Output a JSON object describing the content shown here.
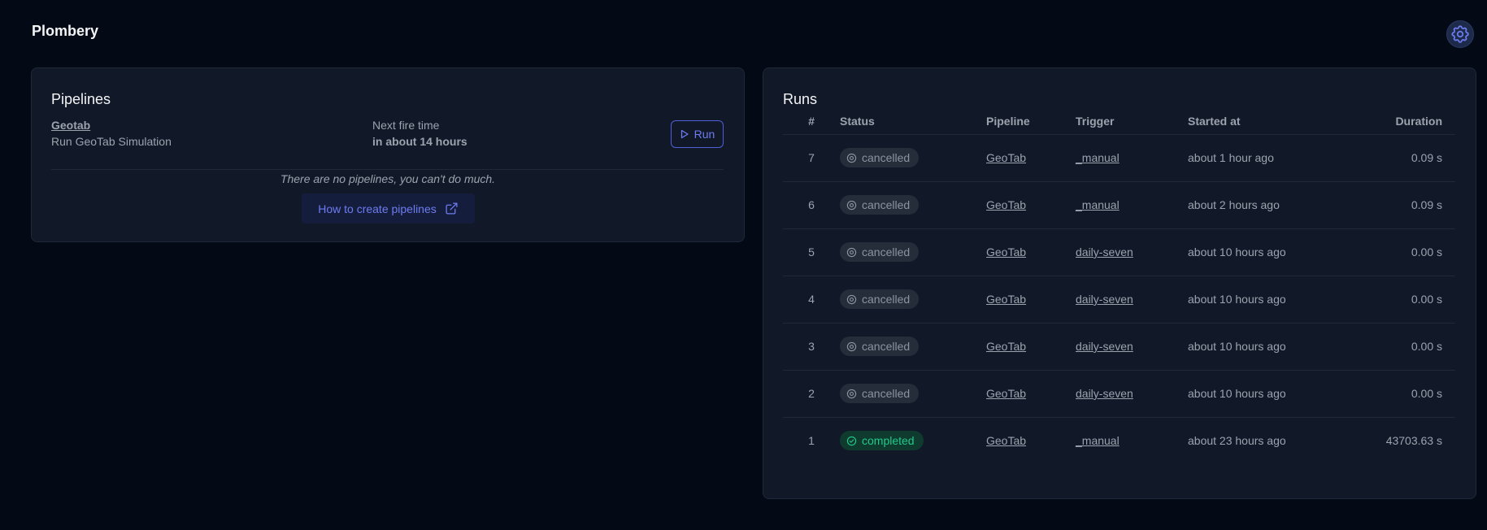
{
  "app": {
    "title": "Plombery",
    "settings_icon": "gear-icon"
  },
  "pipelines": {
    "title": "Pipelines",
    "item": {
      "name": "Geotab",
      "description": "Run GeoTab Simulation",
      "next_fire_label": "Next fire time",
      "next_fire_value": "in about 14 hours",
      "run_label": "Run"
    },
    "empty_message": "There are no pipelines, you can't do much.",
    "howto_label": "How to create pipelines"
  },
  "runs": {
    "title": "Runs",
    "columns": [
      "#",
      "Status",
      "Pipeline",
      "Trigger",
      "Started at",
      "Duration"
    ],
    "rows": [
      {
        "num": "7",
        "status": "cancelled",
        "pipeline": "GeoTab",
        "trigger": "_manual",
        "started": "about 1 hour ago",
        "duration": "0.09 s"
      },
      {
        "num": "6",
        "status": "cancelled",
        "pipeline": "GeoTab",
        "trigger": "_manual",
        "started": "about 2 hours ago",
        "duration": "0.09 s"
      },
      {
        "num": "5",
        "status": "cancelled",
        "pipeline": "GeoTab",
        "trigger": "daily-seven",
        "started": "about 10 hours ago",
        "duration": "0.00 s"
      },
      {
        "num": "4",
        "status": "cancelled",
        "pipeline": "GeoTab",
        "trigger": "daily-seven",
        "started": "about 10 hours ago",
        "duration": "0.00 s"
      },
      {
        "num": "3",
        "status": "cancelled",
        "pipeline": "GeoTab",
        "trigger": "daily-seven",
        "started": "about 10 hours ago",
        "duration": "0.00 s"
      },
      {
        "num": "2",
        "status": "cancelled",
        "pipeline": "GeoTab",
        "trigger": "daily-seven",
        "started": "about 10 hours ago",
        "duration": "0.00 s"
      },
      {
        "num": "1",
        "status": "completed",
        "pipeline": "GeoTab",
        "trigger": "_manual",
        "started": "about 23 hours ago",
        "duration": "43703.63 s"
      }
    ]
  },
  "colors": {
    "background": "#030a16",
    "card": "#111827",
    "accent": "#6d7cf0",
    "cancelled": "#8b93a1",
    "completed": "#22c98a"
  }
}
